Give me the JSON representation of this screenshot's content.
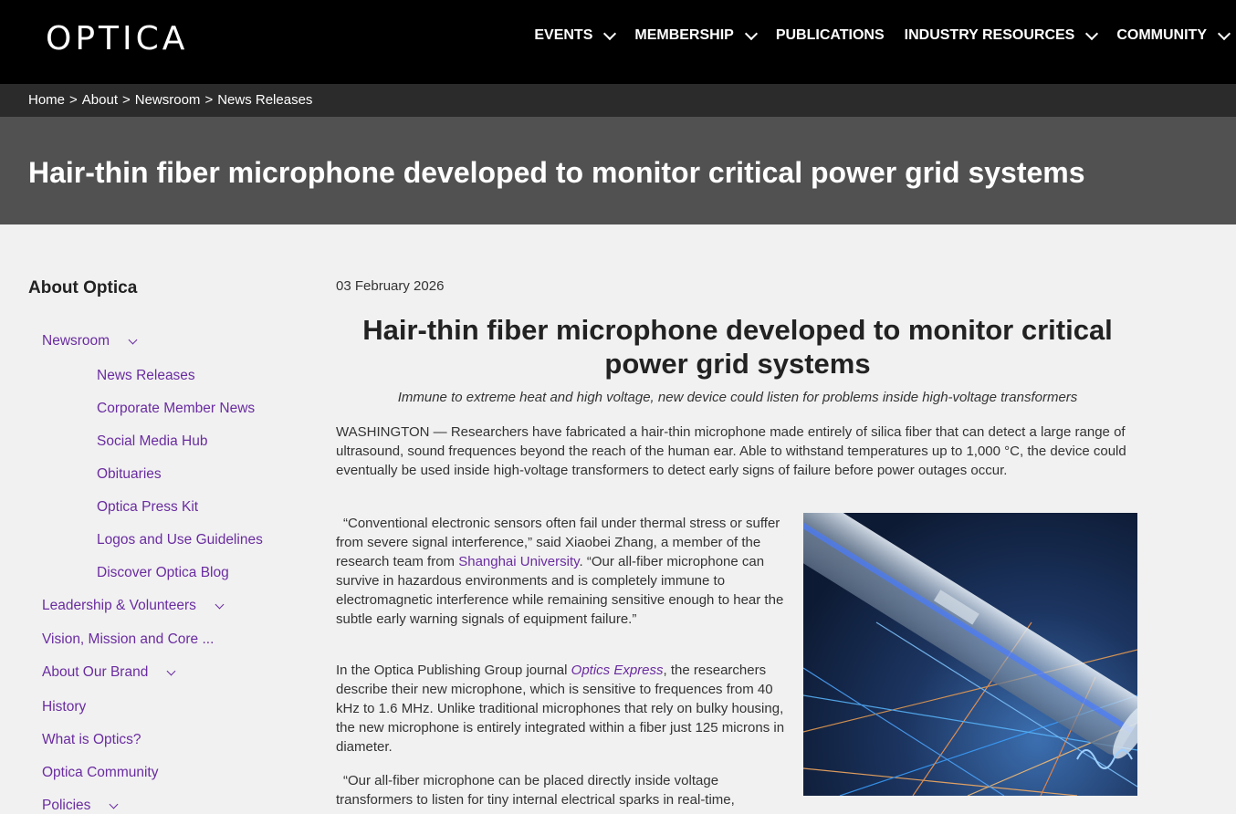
{
  "brand": {
    "logo_text": "OPTICA"
  },
  "nav": {
    "items": [
      {
        "label": "EVENTS",
        "has_dropdown": true
      },
      {
        "label": "MEMBERSHIP",
        "has_dropdown": true
      },
      {
        "label": "PUBLICATIONS",
        "has_dropdown": false
      },
      {
        "label": "INDUSTRY RESOURCES",
        "has_dropdown": true
      },
      {
        "label": "COMMUNITY",
        "has_dropdown": true
      }
    ]
  },
  "breadcrumb": {
    "items": [
      "Home",
      "About",
      "Newsroom",
      "News Releases"
    ],
    "separator": ">"
  },
  "banner": {
    "title": "Hair-thin fiber microphone developed to monitor critical power grid systems"
  },
  "sidebar": {
    "heading": "About Optica",
    "items": [
      {
        "label": "Newsroom",
        "has_dropdown": true,
        "level": 1
      },
      {
        "label": "News Releases",
        "level": 2
      },
      {
        "label": "Corporate Member News",
        "level": 2
      },
      {
        "label": "Social Media Hub",
        "level": 2
      },
      {
        "label": "Obituaries",
        "level": 2
      },
      {
        "label": "Optica Press Kit",
        "level": 2
      },
      {
        "label": "Logos and Use Guidelines",
        "level": 2
      },
      {
        "label": "Discover Optica Blog",
        "level": 2
      },
      {
        "label": "Leadership & Volunteers",
        "has_dropdown": true,
        "level": 1
      },
      {
        "label": "Vision, Mission and Core ...",
        "level": 1
      },
      {
        "label": "About Our Brand",
        "has_dropdown": true,
        "level": 1
      },
      {
        "label": "History",
        "level": 1
      },
      {
        "label": "What is Optics?",
        "level": 1
      },
      {
        "label": "Optica Community",
        "level": 1
      },
      {
        "label": "Policies",
        "has_dropdown": true,
        "level": 1
      }
    ]
  },
  "article": {
    "date": "03 February 2026",
    "title_line1": "Hair-thin fiber microphone developed to monitor critical",
    "title_line2": "power grid systems",
    "subtitle": "Immune to extreme heat and high voltage, new device could listen for problems inside high-voltage transformers",
    "p1": "WASHINGTON — Researchers have fabricated a hair-thin microphone made entirely of silica fiber that can detect a large range of ultrasound, sound frequences beyond the reach of the human ear. Able to withstand temperatures up to 1,000 °C, the device could eventually be used inside high-voltage transformers to detect early signs of failure before power outages occur.",
    "p2_before": "“Conventional electronic sensors often fail under thermal stress or suffer from severe signal interference,”   said Xiaobei Zhang, a member of the research team from ",
    "p2_link": "Shanghai University",
    "p2_after": ".   “Our all-fiber microphone can survive in hazardous environments and is completely immune to electromagnetic interference while remaining sensitive enough to hear the subtle early warning signals of equipment failure.”",
    "p3_before": "In the Optica Publishing Group journal ",
    "p3_link": "Optics Express",
    "p3_after": ", the researchers describe their new microphone, which is sensitive to frequences from 40 kHz to 1.6 MHz. Unlike traditional microphones that rely on bulky housing, the new microphone is entirely integrated within a fiber just 125 microns in diameter.",
    "p4": "“Our all-fiber microphone can be placed directly inside voltage transformers to listen for tiny internal electrical sparks in real-time,"
  }
}
